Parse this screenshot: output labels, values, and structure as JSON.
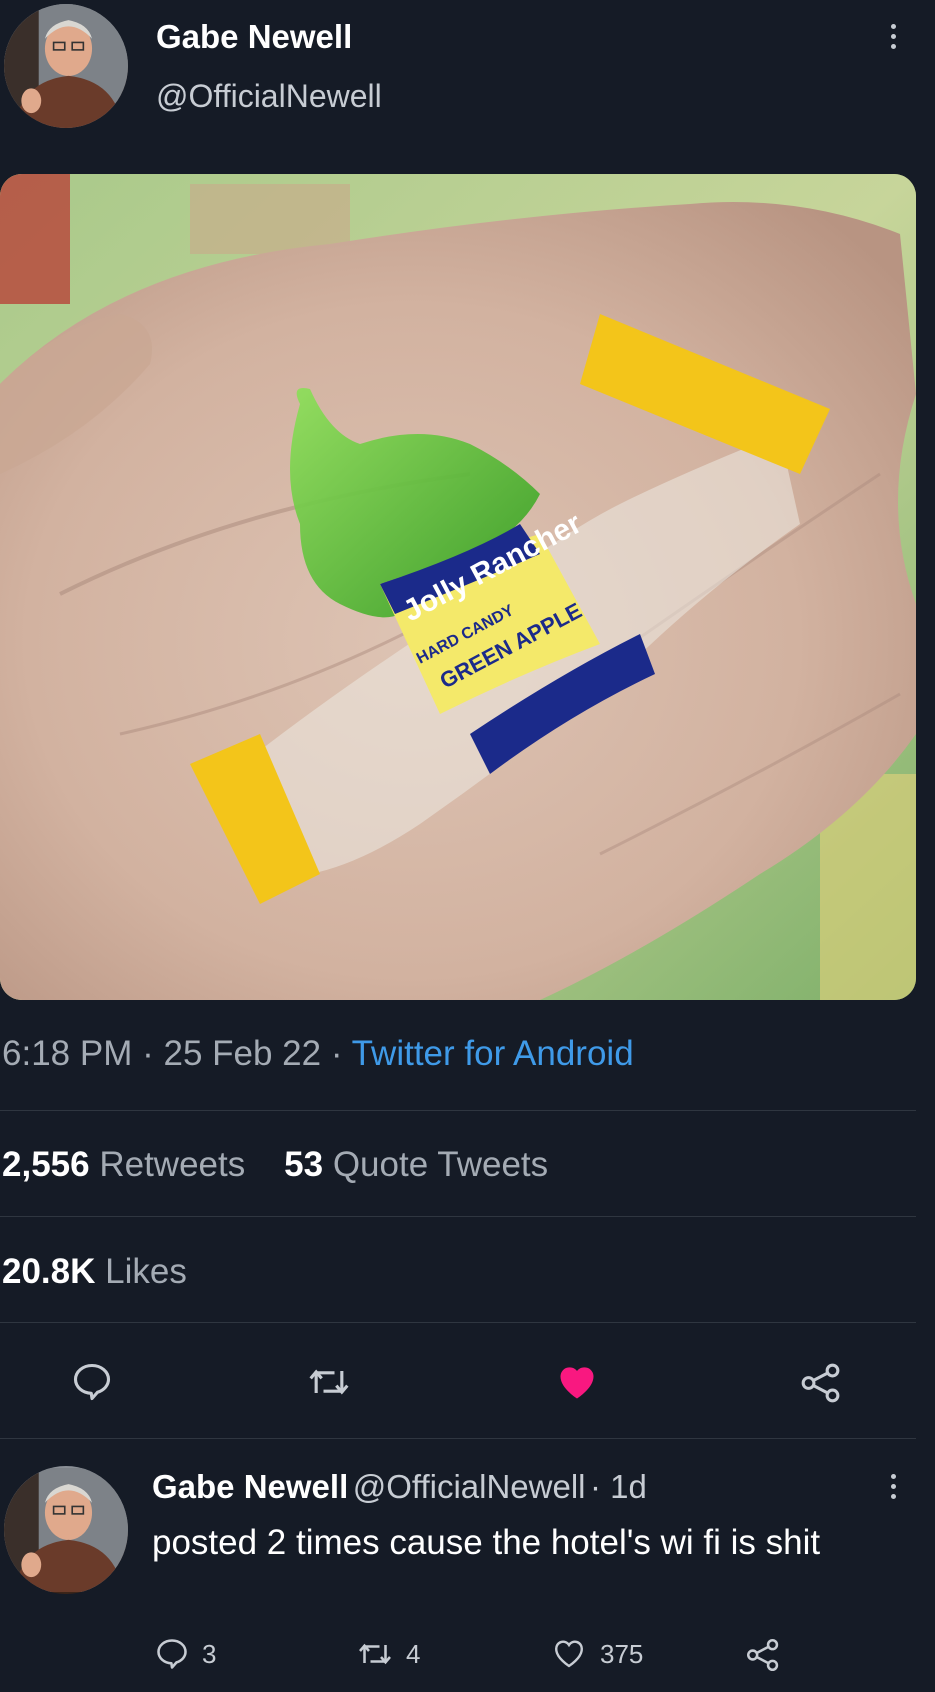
{
  "tweet": {
    "author_name": "Gabe Newell",
    "author_handle": "@OfficialNewell",
    "time": "6:18 PM",
    "date": "25 Feb 22",
    "source": "Twitter for Android",
    "separator": "·",
    "retweets_count": "2,556",
    "retweets_label": "Retweets",
    "quote_count": "53",
    "quote_label": "Quote Tweets",
    "likes_count": "20.8K",
    "likes_label": "Likes",
    "liked": true,
    "like_color": "#f91880",
    "link_color": "#3f9ae8",
    "photo_text": {
      "brand": "Jolly Rancher",
      "candy_type": "HARD CANDY",
      "flavor": "GREEN APPLE",
      "brand_short": "Jolly"
    }
  },
  "reply": {
    "author_name": "Gabe Newell",
    "author_handle": "@OfficialNewell",
    "age": "· 1d",
    "text": "posted 2 times cause the hotel's wi fi is shit",
    "reply_count": "3",
    "retweet_count": "4",
    "like_count": "375"
  },
  "icons": [
    "more-icon",
    "reply-icon",
    "retweet-icon",
    "heart-icon",
    "share-icon"
  ]
}
